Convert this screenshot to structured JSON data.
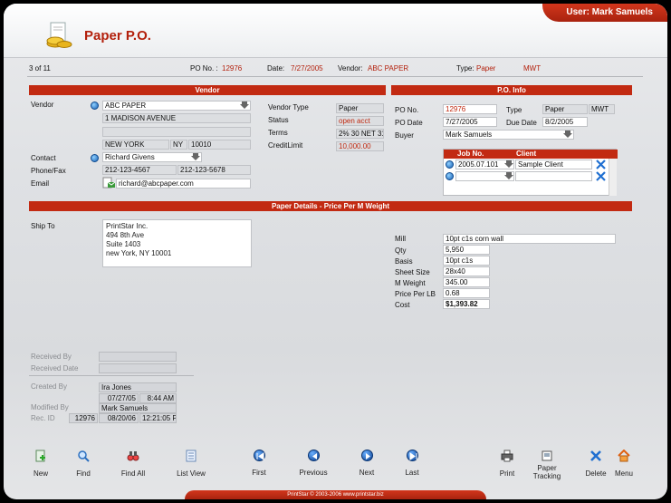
{
  "header": {
    "user_label": "User: Mark Samuels",
    "title": "Paper P.O."
  },
  "strip": {
    "record_pos": "3 of 11",
    "po_no_label": "PO No. :",
    "po_no": "12976",
    "date_label": "Date:",
    "date": "7/27/2005",
    "vendor_label": "Vendor:",
    "vendor": "ABC PAPER",
    "type_label": "Type:",
    "type": "Paper",
    "type2": "MWT"
  },
  "vendor": {
    "section_title": "Vendor",
    "vendor_label": "Vendor",
    "name": "ABC PAPER",
    "address1": "1 MADISON AVENUE",
    "address2": "",
    "city": "NEW YORK",
    "state": "NY",
    "zip": "10010",
    "contact_label": "Contact",
    "contact": "Richard Givens",
    "phone_label": "Phone/Fax",
    "phone": "212-123-4567",
    "fax": "212-123-5678",
    "email_label": "Email",
    "email": "richard@abcpaper.com",
    "vendor_type_label": "Vendor Type",
    "vendor_type": "Paper",
    "status_label": "Status",
    "status": "open acct",
    "terms_label": "Terms",
    "terms": "2% 30 NET 31",
    "credit_label": "CreditLimit",
    "credit": "10,000.00"
  },
  "po_info": {
    "section_title": "P.O. Info",
    "po_no_label": "PO No.",
    "po_no": "12976",
    "type_label": "Type",
    "type": "Paper",
    "type2": "MWT",
    "po_date_label": "PO Date",
    "po_date": "7/27/2005",
    "due_date_label": "Due Date",
    "due_date": "8/2/2005",
    "buyer_label": "Buyer",
    "buyer": "Mark Samuels",
    "grid_col_job": "Job No.",
    "grid_col_client": "Client",
    "rows": [
      {
        "job": "2005.07.101",
        "client": "Sample Client"
      },
      {
        "job": "",
        "client": ""
      }
    ]
  },
  "paper": {
    "section_title": "Paper Details - Price Per M Weight",
    "ship_to_label": "Ship To",
    "ship_to": [
      "PrintStar Inc.",
      "494 8th Ave",
      "Suite 1403",
      "new York, NY 10001"
    ],
    "mill_label": "Mill",
    "mill": "10pt c1s corn wall",
    "qty_label": "Qty",
    "qty": "5,950",
    "basis_label": "Basis",
    "basis": "10pt c1s",
    "sheet_label": "Sheet Size",
    "sheet": "28x40",
    "mweight_label": "M Weight",
    "mweight": "345.00",
    "ppl_label": "Price Per LB",
    "ppl": "0.68",
    "cost_label": "Cost",
    "cost": "$1,393.82"
  },
  "audit": {
    "received_by_label": "Received By",
    "received_date_label": "Received Date",
    "created_by_label": "Created By",
    "created_by": "Ira Jones",
    "created_date": "07/27/05",
    "created_time": "8:44 AM",
    "modified_by_label": "Modified By",
    "modified_by": "Mark Samuels",
    "rec_id_label": "Rec. ID",
    "rec_id": "12976",
    "modified_date": "08/20/06",
    "modified_time": "12:21:05 PM"
  },
  "toolbar": {
    "new": "New",
    "find": "Find",
    "find_all": "Find All",
    "list_view": "List View",
    "first": "First",
    "previous": "Previous",
    "next": "Next",
    "last": "Last",
    "print": "Print",
    "paper_tracking_1": "Paper",
    "paper_tracking_2": "Tracking",
    "delete": "Delete",
    "menu": "Menu"
  },
  "footer": "PrintStar © 2003-2006 www.printstar.biz",
  "colors": {
    "accent": "#c22a12",
    "value_red": "#b3200c"
  }
}
